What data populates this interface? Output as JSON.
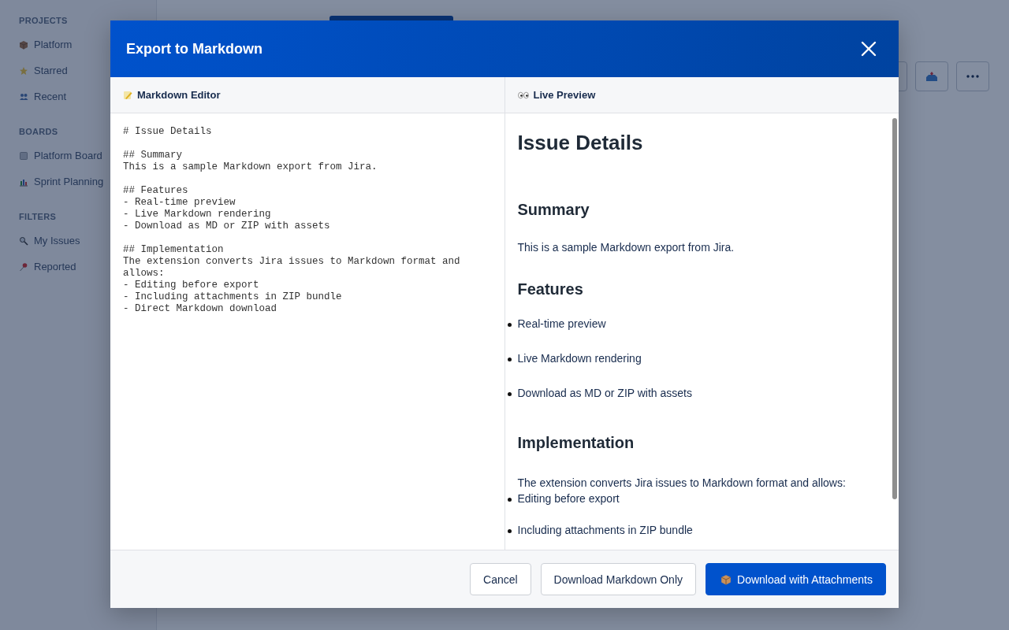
{
  "sidebar": {
    "sections": [
      {
        "title": "PROJECTS",
        "items": [
          {
            "kind": "box",
            "label": "Platform"
          },
          {
            "kind": "star",
            "label": "Starred"
          },
          {
            "kind": "people",
            "label": "Recent"
          }
        ]
      },
      {
        "title": "BOARDS",
        "items": [
          {
            "kind": "board",
            "label": "Platform Board"
          },
          {
            "kind": "chart",
            "label": "Sprint Planning"
          }
        ]
      },
      {
        "title": "FILTERS",
        "items": [
          {
            "kind": "search",
            "label": "My Issues"
          },
          {
            "kind": "pin",
            "label": "Reported"
          }
        ]
      }
    ]
  },
  "toolbar": {
    "buttons": [
      {
        "kind": "blank"
      },
      {
        "kind": "inbox"
      },
      {
        "kind": "more"
      }
    ]
  },
  "dialog": {
    "title": "Export to Markdown",
    "editor": {
      "title": "Markdown Editor",
      "text": "# Issue Details\n\n## Summary\nThis is a sample Markdown export from Jira.\n\n## Features\n- Real-time preview\n- Live Markdown rendering\n- Download as MD or ZIP with assets\n\n## Implementation\nThe extension converts Jira issues to Markdown format and allows:\n- Editing before export\n- Including attachments in ZIP bundle\n- Direct Markdown download"
    },
    "preview": {
      "title": "Live Preview",
      "blocks": [
        {
          "kind": "h1",
          "text": "Issue Details"
        },
        {
          "kind": "h2",
          "text": "Summary"
        },
        {
          "kind": "p",
          "text": "This is a sample Markdown export from Jira."
        },
        {
          "kind": "h2",
          "text": "Features"
        },
        {
          "kind": "ul",
          "items": [
            "Real-time preview",
            "Live Markdown rendering",
            "Download as MD or ZIP with assets"
          ]
        },
        {
          "kind": "h2",
          "text": "Implementation"
        },
        {
          "kind": "p",
          "text": "The extension converts Jira issues to Markdown format and allows:"
        },
        {
          "kind": "ul",
          "items": [
            "Editing before export",
            "Including attachments in ZIP bundle"
          ]
        }
      ]
    },
    "buttons": [
      {
        "kind": "default",
        "label": "Cancel"
      },
      {
        "kind": "default",
        "label": "Download Markdown Only"
      },
      {
        "kind": "primary",
        "label": "Download with Attachments"
      }
    ]
  }
}
